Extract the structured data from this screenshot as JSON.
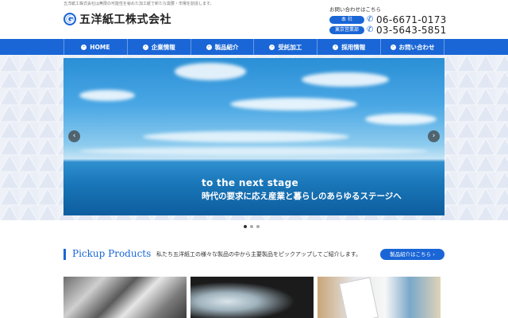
{
  "header": {
    "tagline": "五洋紙工株式会社は無限の可能性を秘めた加工紙で新たな需要・市場を創造します。",
    "logo_mark": "G",
    "company_name": "五洋紙工株式会社",
    "contact_title": "お問い合わせはこちら",
    "contacts": [
      {
        "label": "本 社",
        "phone": "06-6671-0173"
      },
      {
        "label": "東京営業部",
        "phone": "03-5643-5851"
      }
    ]
  },
  "nav": {
    "items": [
      {
        "label": "HOME"
      },
      {
        "label": "企業情報"
      },
      {
        "label": "製品紹介"
      },
      {
        "label": "受託加工"
      },
      {
        "label": "採用情報"
      },
      {
        "label": "お問い合わせ"
      }
    ],
    "accent_color": "#1a66d6"
  },
  "hero": {
    "line1": "to the next stage",
    "line2": "時代の要求に応え産業と暮らしのあらゆるステージへ",
    "prev_arrow": "‹",
    "next_arrow": "›",
    "slide_count": 3,
    "active_slide": 1
  },
  "pickup": {
    "title": "Pickup Products",
    "description": "私たち五洋紙工の様々な製品の中から主要製品をピックアップしてご紹介します。",
    "button_label": "製品紹介はこちら ›"
  },
  "icons": {
    "phone": "phone-icon",
    "nav_bullet": "chevron-right-icon"
  }
}
